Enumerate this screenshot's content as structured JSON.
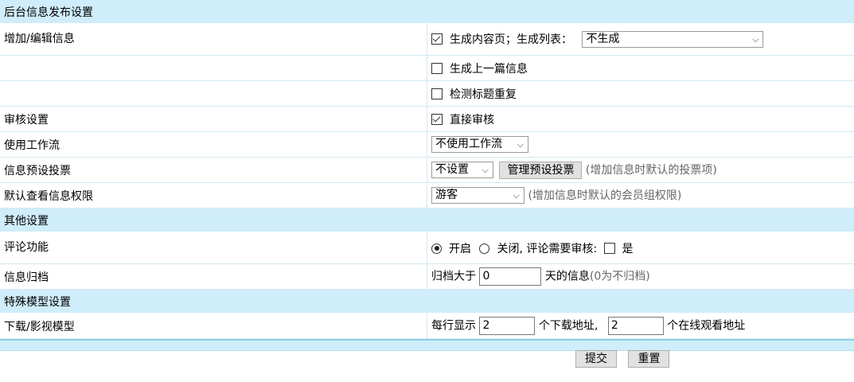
{
  "sections": {
    "backend": "后台信息发布设置",
    "other": "其他设置",
    "special": "特殊模型设置"
  },
  "add_edit": {
    "label": "增加/编辑信息",
    "gen_content": "生成内容页；生成列表：",
    "list_select": "不生成",
    "gen_prev": "生成上一篇信息",
    "check_title": "检测标题重复"
  },
  "audit": {
    "label": "审核设置",
    "direct": "直接审核"
  },
  "workflow": {
    "label": "使用工作流",
    "select": "不使用工作流"
  },
  "vote": {
    "label": "信息预设投票",
    "select": "不设置",
    "manage_btn": "管理预设投票",
    "hint": "(增加信息时默认的投票项)"
  },
  "permission": {
    "label": "默认查看信息权限",
    "select": "游客",
    "hint": "(增加信息时默认的会员组权限)"
  },
  "comment": {
    "label": "评论功能",
    "on": "开启",
    "off": "关闭,",
    "audit_q": "评论需要审核:",
    "yes": "是"
  },
  "archive": {
    "label": "信息归档",
    "prefix": "归档大于",
    "value": "0",
    "suffix": "天的信息",
    "hint": "(0为不归档)"
  },
  "download": {
    "label": "下载/影视模型",
    "prefix": "每行显示",
    "dl_value": "2",
    "dl_text": "个下载地址,",
    "online_value": "2",
    "online_text": "个在线观看地址"
  },
  "actions": {
    "submit": "提交",
    "reset": "重置"
  }
}
